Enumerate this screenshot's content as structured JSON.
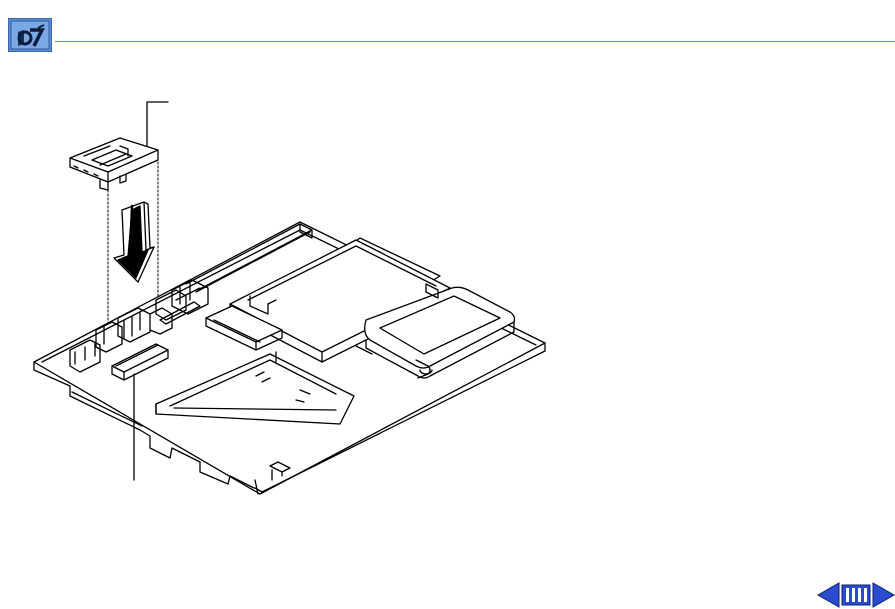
{
  "header": {
    "logo_icon": "toolbox-logo-icon",
    "rule_color": "#4a8ed0"
  },
  "illustration": {
    "subject": "logic-board-cache-card-install-icon",
    "arrow_icon": "arrow-down-icon"
  },
  "nav": {
    "prev_icon": "triangle-left-icon",
    "index_icon": "index-bars-icon",
    "next_icon": "triangle-right-icon",
    "accent": "#2a4cd0"
  }
}
